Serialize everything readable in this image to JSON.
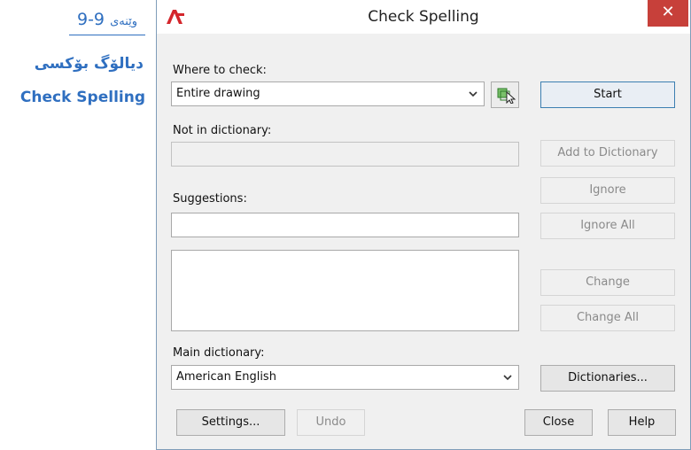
{
  "caption": {
    "figure_word": "وێنەی",
    "figure_number": "9-9",
    "line1": "دیالۆگ بۆکسی",
    "line2": "Check Spelling"
  },
  "window": {
    "title": "Check Spelling",
    "close_glyph": "✕",
    "icon": "autocad-logo-icon"
  },
  "where_to_check": {
    "label": "Where to check:",
    "value": "Entire drawing",
    "select_objects_icon": "select-objects-icon"
  },
  "not_in_dictionary": {
    "label": "Not in dictionary:",
    "value": ""
  },
  "suggestions": {
    "label": "Suggestions:",
    "value": "",
    "list": []
  },
  "main_dictionary": {
    "label": "Main dictionary:",
    "value": "American English"
  },
  "buttons": {
    "start": "Start",
    "add_to_dictionary": "Add to Dictionary",
    "ignore": "Ignore",
    "ignore_all": "Ignore All",
    "change": "Change",
    "change_all": "Change All",
    "dictionaries": "Dictionaries...",
    "settings": "Settings...",
    "undo": "Undo",
    "close": "Close",
    "help": "Help"
  },
  "colors": {
    "caption_blue": "#2f6fc0",
    "close_red": "#c7403a",
    "dialog_bg": "#f0f0f0",
    "focus_border": "#3c7fb1",
    "disabled_text": "#8a8a8a"
  }
}
